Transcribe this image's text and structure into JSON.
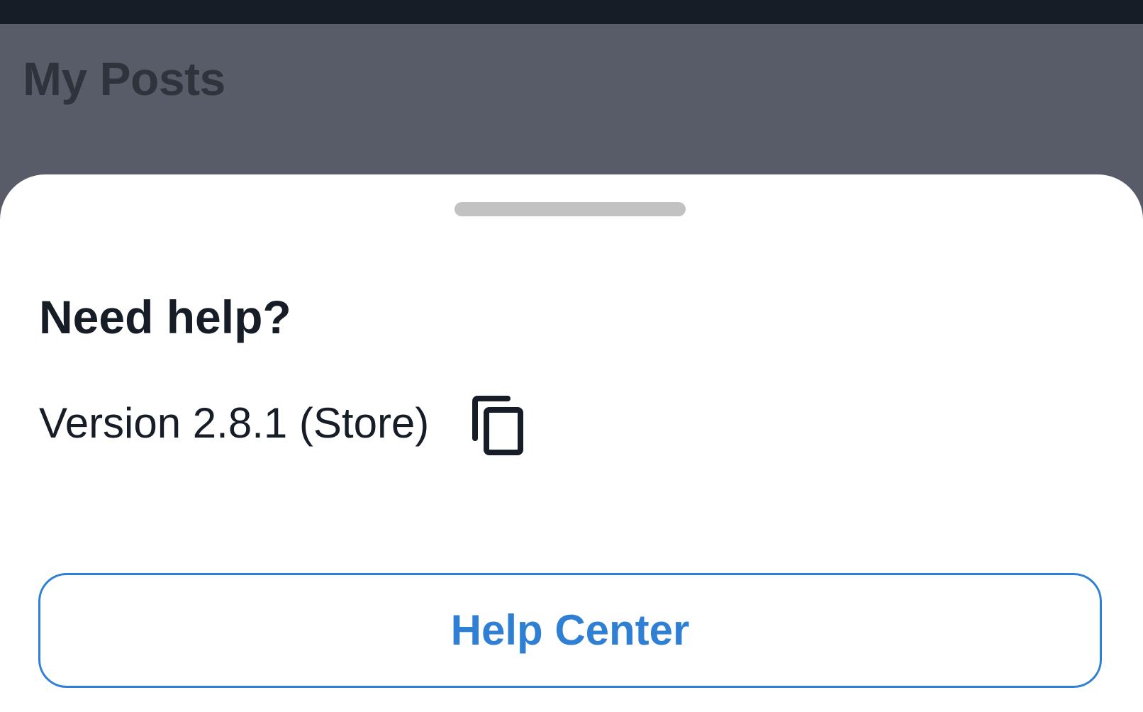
{
  "background_screen": {
    "title": "My Posts"
  },
  "help_sheet": {
    "title": "Need help?",
    "version_text": "Version 2.8.1 (Store)",
    "copy_icon": "copy-icon",
    "help_center_label": "Help Center"
  },
  "colors": {
    "status_bar": "#161d26",
    "scrim_background": "#585c68",
    "sheet_background": "#ffffff",
    "primary_text": "#161d26",
    "accent": "#2f7fd4",
    "drag_handle": "#c2c2c2"
  }
}
